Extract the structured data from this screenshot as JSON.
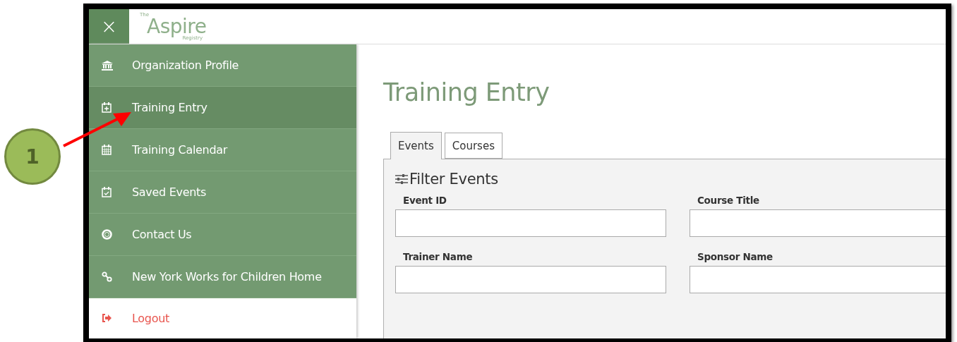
{
  "callout": {
    "label": "1"
  },
  "header": {
    "close": "×",
    "logo": {
      "small_top": "The",
      "name": "Aspire",
      "small_bottom": "Registry"
    }
  },
  "sidebar": {
    "items": [
      {
        "label": "Organization Profile",
        "kind": "nav",
        "selected": false
      },
      {
        "label": "Training Entry",
        "kind": "nav",
        "selected": true
      },
      {
        "label": "Training Calendar",
        "kind": "nav",
        "selected": false
      },
      {
        "label": "Saved Events",
        "kind": "nav",
        "selected": false
      },
      {
        "label": "Contact Us",
        "kind": "nav",
        "selected": false
      },
      {
        "label": "New York Works for Children Home",
        "kind": "nav",
        "selected": false
      },
      {
        "label": "Logout",
        "kind": "logout",
        "selected": false
      }
    ]
  },
  "page": {
    "title": "Training Entry",
    "tabs": [
      {
        "label": "Events",
        "selected": true
      },
      {
        "label": "Courses",
        "selected": false
      }
    ],
    "filter": {
      "title": "Filter Events",
      "fields": [
        {
          "label": "Event ID"
        },
        {
          "label": "Course Title"
        },
        {
          "label": "Trainer Name"
        },
        {
          "label": "Sponsor Name"
        }
      ]
    }
  }
}
